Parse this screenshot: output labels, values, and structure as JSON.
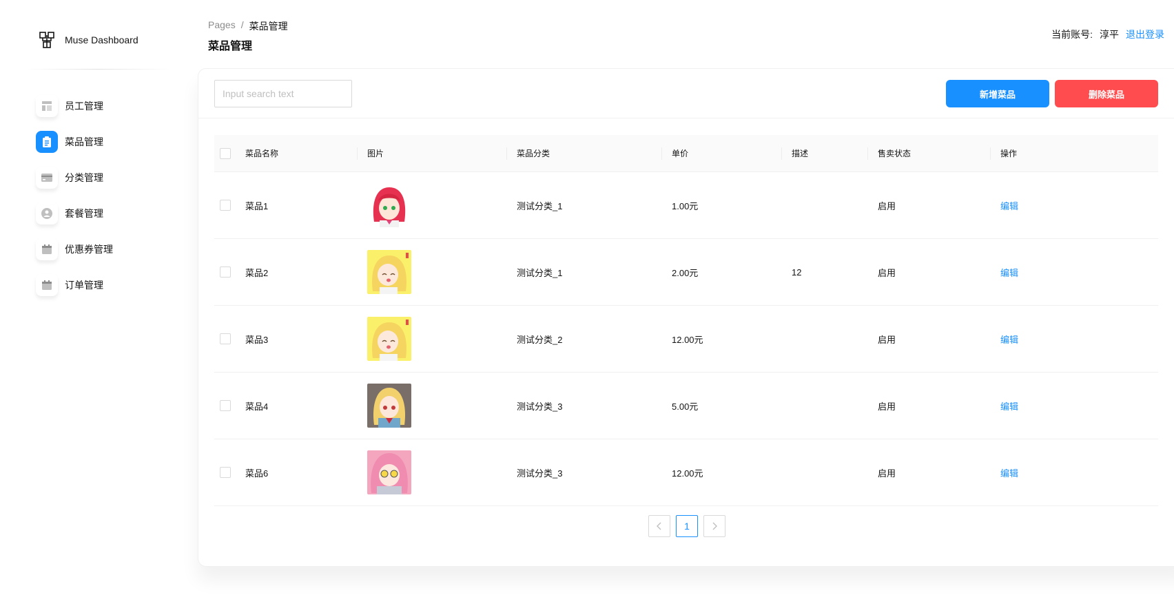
{
  "brand": {
    "name": "Muse Dashboard"
  },
  "sidebar": {
    "items": [
      {
        "label": "员工管理",
        "icon": "layout-icon",
        "active": false
      },
      {
        "label": "菜品管理",
        "icon": "clipboard-icon",
        "active": true
      },
      {
        "label": "分类管理",
        "icon": "card-icon",
        "active": false
      },
      {
        "label": "套餐管理",
        "icon": "user-circle-icon",
        "active": false
      },
      {
        "label": "优惠券管理",
        "icon": "calendar-icon",
        "active": false
      },
      {
        "label": "订单管理",
        "icon": "calendar-icon",
        "active": false
      }
    ]
  },
  "header": {
    "breadcrumb_root": "Pages",
    "breadcrumb_sep": "/",
    "breadcrumb_current": "菜品管理",
    "title": "菜品管理",
    "account_label": "当前账号:",
    "account_user": "淳平",
    "logout": "退出登录"
  },
  "toolbar": {
    "search_placeholder": "Input search text",
    "add_label": "新增菜品",
    "delete_label": "删除菜品"
  },
  "table": {
    "columns": [
      "菜品名称",
      "图片",
      "菜品分类",
      "单价",
      "描述",
      "售卖状态",
      "操作"
    ],
    "rows": [
      {
        "name": "菜品1",
        "category": "测试分类_1",
        "price": "1.00元",
        "desc": "",
        "status": "启用",
        "action": "编辑"
      },
      {
        "name": "菜品2",
        "category": "测试分类_1",
        "price": "2.00元",
        "desc": "12",
        "status": "启用",
        "action": "编辑"
      },
      {
        "name": "菜品3",
        "category": "测试分类_2",
        "price": "12.00元",
        "desc": "",
        "status": "启用",
        "action": "编辑"
      },
      {
        "name": "菜品4",
        "category": "测试分类_3",
        "price": "5.00元",
        "desc": "",
        "status": "启用",
        "action": "编辑"
      },
      {
        "name": "菜品6",
        "category": "测试分类_3",
        "price": "12.00元",
        "desc": "",
        "status": "启用",
        "action": "编辑"
      }
    ]
  },
  "pagination": {
    "current": "1"
  },
  "colors": {
    "primary": "#1890ff",
    "danger": "#ff4d4f"
  }
}
